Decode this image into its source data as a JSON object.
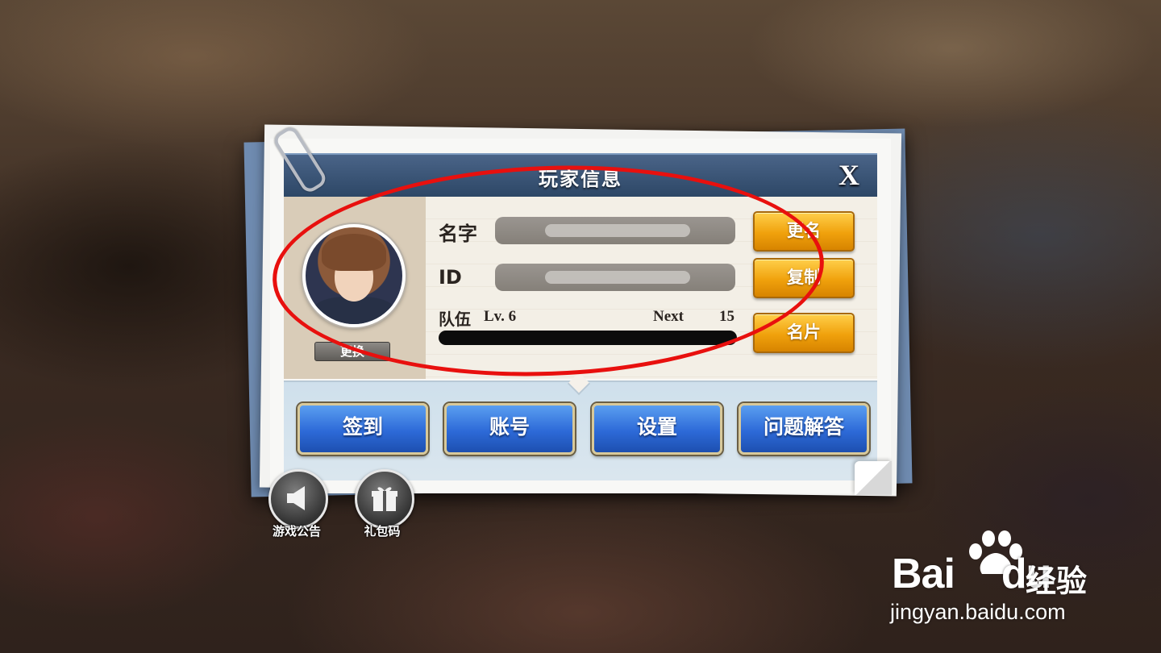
{
  "dialog": {
    "title": "玩家信息",
    "close_label": "X"
  },
  "profile": {
    "change_avatar_label": "更换",
    "name_label": "名字",
    "id_label": "ID",
    "team_label": "队伍",
    "level_text": "Lv. 6",
    "next_label": "Next",
    "next_value": "15",
    "xp_progress": 0
  },
  "side_buttons": {
    "rename_label": "更名",
    "copy_label": "复制",
    "card_label": "名片"
  },
  "bottom_buttons": [
    {
      "label": "签到"
    },
    {
      "label": "账号"
    },
    {
      "label": "设置"
    },
    {
      "label": "问题解答"
    }
  ],
  "shortcuts": [
    {
      "label": "游戏公告",
      "icon": "speaker-icon"
    },
    {
      "label": "礼包码",
      "icon": "gift-icon"
    }
  ],
  "watermark": {
    "brand_left": "Bai",
    "brand_right": "du",
    "product": "经验",
    "url": "jingyan.baidu.com"
  },
  "colors": {
    "highlight_ellipse": "#e8100e",
    "orange_button": "#f0a10c",
    "blue_button": "#2d6ad8"
  }
}
